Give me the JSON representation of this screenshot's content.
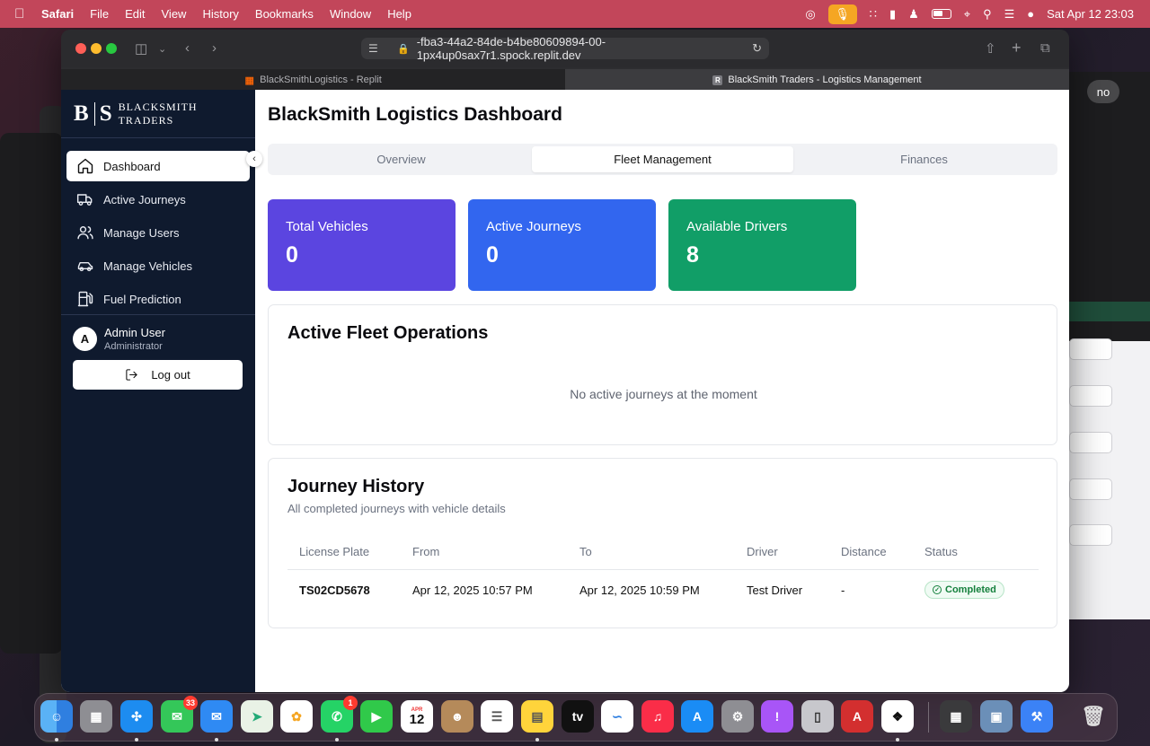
{
  "menubar": {
    "app": "Safari",
    "items": [
      "File",
      "Edit",
      "View",
      "History",
      "Bookmarks",
      "Window",
      "Help"
    ],
    "clock": "Sat Apr 12  23:03"
  },
  "browser": {
    "url": "-fba3-44a2-84de-b4be80609894-00-1px4up0sax7r1.spock.replit.dev",
    "tabs": [
      {
        "title": "BlackSmithLogistics - Replit"
      },
      {
        "title": "BlackSmith Traders - Logistics Management"
      }
    ]
  },
  "background": {
    "pill_text": "no"
  },
  "sidebar": {
    "brand_logo": "B|S",
    "brand_logo_left": "B",
    "brand_logo_right": "S",
    "brand_name": "BLACKSMITH TRADERS",
    "items": [
      {
        "label": "Dashboard",
        "icon": "home-icon"
      },
      {
        "label": "Active Journeys",
        "icon": "truck-icon"
      },
      {
        "label": "Manage Users",
        "icon": "users-icon"
      },
      {
        "label": "Manage Vehicles",
        "icon": "car-icon"
      },
      {
        "label": "Fuel Prediction",
        "icon": "fuel-icon"
      }
    ],
    "user": {
      "initial": "A",
      "name": "Admin User",
      "role": "Administrator"
    },
    "logout_label": "Log out"
  },
  "main": {
    "title": "BlackSmith Logistics Dashboard",
    "tabs": [
      {
        "label": "Overview"
      },
      {
        "label": "Fleet Management"
      },
      {
        "label": "Finances"
      }
    ],
    "stats": [
      {
        "label": "Total Vehicles",
        "value": "0",
        "color": "#5b45e0"
      },
      {
        "label": "Active Journeys",
        "value": "0",
        "color": "#3266ef"
      },
      {
        "label": "Available Drivers",
        "value": "8",
        "color": "#119e67"
      }
    ],
    "fleet_ops": {
      "title": "Active Fleet Operations",
      "empty": "No active journeys at the moment"
    },
    "history": {
      "title": "Journey History",
      "subtitle": "All completed journeys with vehicle details",
      "columns": [
        "License Plate",
        "From",
        "To",
        "Driver",
        "Distance",
        "Status"
      ],
      "rows": [
        {
          "plate": "TS02CD5678",
          "from": "Apr 12, 2025 10:57 PM",
          "to": "Apr 12, 2025 10:59 PM",
          "driver": "Test Driver",
          "distance": "-",
          "status": "Completed"
        }
      ]
    }
  },
  "dock": {
    "messages_badge": "33",
    "whatsapp_badge": "1",
    "calendar_month": "APR",
    "calendar_day": "12"
  }
}
